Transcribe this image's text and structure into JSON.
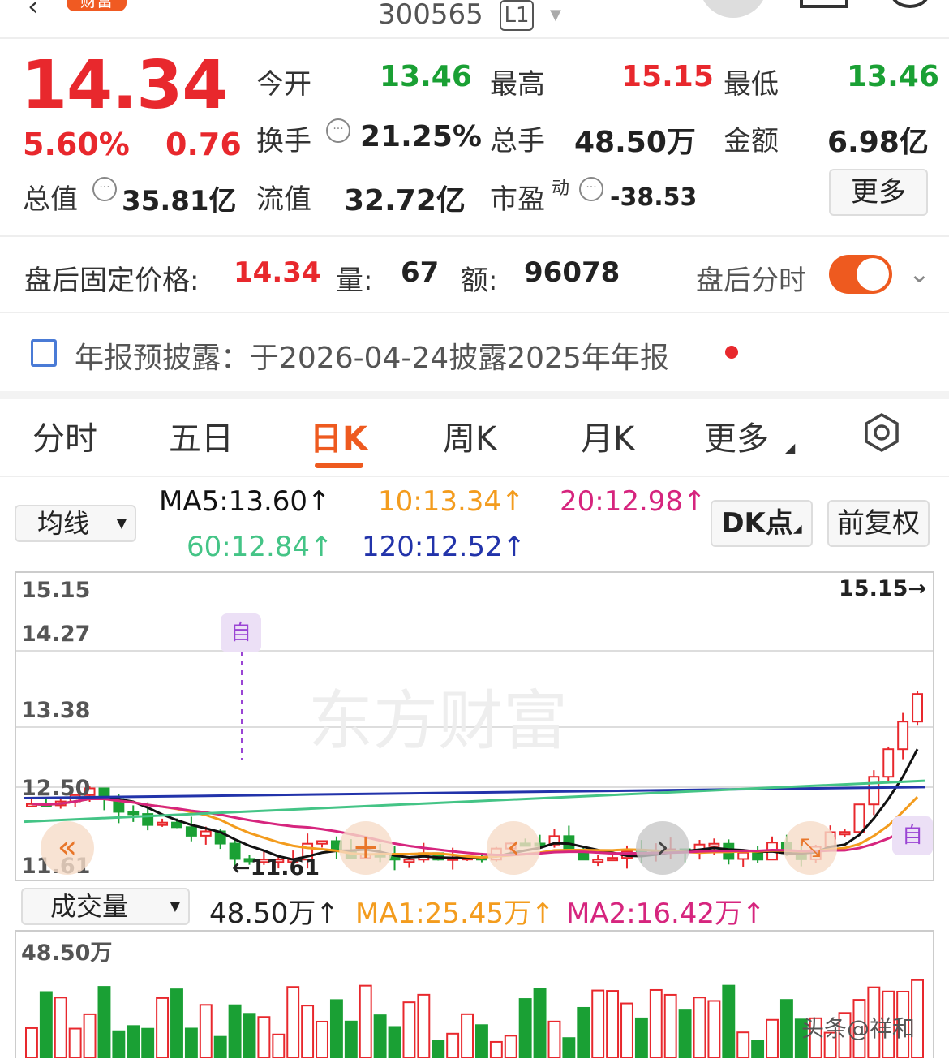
{
  "header": {
    "badge": "财富",
    "code": "300565",
    "level": "L1"
  },
  "quote": {
    "price": "14.34",
    "change_pct": "5.60%",
    "change": "0.76",
    "open_label": "今开",
    "open": "13.46",
    "high_label": "最高",
    "high": "15.15",
    "low_label": "最低",
    "low": "13.46",
    "turnover_label": "换手",
    "turnover": "21.25%",
    "volume_label": "总手",
    "volume": "48.50万",
    "amount_label": "金额",
    "amount": "6.98亿",
    "mcap_label": "总值",
    "mcap": "35.81亿",
    "float_label": "流值",
    "float_cap": "32.72亿",
    "pe_label": "市盈",
    "pe_sup": "动",
    "pe": "-38.53",
    "more_label": "更多"
  },
  "after_hours": {
    "price_label": "盘后固定价格:",
    "price": "14.34",
    "qty_label": "量:",
    "qty": "67",
    "amount_label": "额:",
    "amount": "96078",
    "toggle_label": "盘后分时",
    "toggle_on": true
  },
  "notice": {
    "text": "年报预披露：于2026-04-24披露2025年年报"
  },
  "tabs": [
    "分时",
    "五日",
    "日K",
    "周K",
    "月K",
    "更多"
  ],
  "active_tab": "日K",
  "ma": {
    "selector": "均线",
    "ma5": "MA5:13.60↑",
    "ma10": "10:13.34↑",
    "ma20": "20:12.98↑",
    "ma60": "60:12.84↑",
    "ma120": "120:12.52↑",
    "dk_label": "DK点",
    "adjust_label": "前复权"
  },
  "colors": {
    "up": "#e8282d",
    "down": "#1aa034",
    "ma5": "#111111",
    "ma10": "#f39c1e",
    "ma20": "#d6257e",
    "ma60": "#44c486",
    "ma120": "#2233aa",
    "accent": "#ee5a1f"
  },
  "kline": {
    "y_labels": [
      "15.15",
      "14.27",
      "13.38",
      "12.50",
      "11.61"
    ],
    "max_marker": "15.15→",
    "min_marker": "←11.61",
    "mark_label": "自",
    "watermark": "东方财富"
  },
  "volume_panel": {
    "selector": "成交量",
    "current": "48.50万↑",
    "ma1": "MA1:25.45万↑",
    "ma2": "MA2:16.42万↑",
    "top_label": "48.50万"
  },
  "footer": {
    "watermark": "头条@祥和"
  }
}
